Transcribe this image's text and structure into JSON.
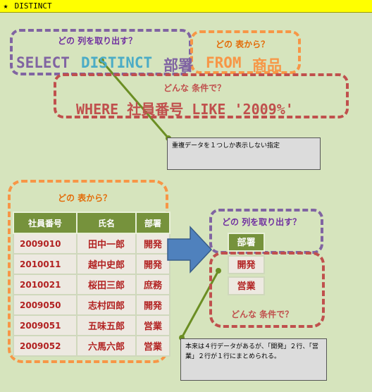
{
  "window": {
    "title": "DISTINCT"
  },
  "colors": {
    "purple": "#8064a2",
    "orange": "#f79646",
    "red": "#c0504d",
    "green_line": "#6b8e23",
    "header_green": "#76923c",
    "arrow_blue": "#4f81bd",
    "teal": "#4bacc6"
  },
  "labels": {
    "which_columns": "どの 列を取り出す？",
    "from_which_table": "どの 表から？",
    "what_condition": "どんな 条件で？"
  },
  "sql": {
    "select_kw": "SELECT",
    "distinct_kw": "DISTINCT",
    "column": "部署",
    "from_kw": "FROM",
    "table": "商品",
    "where_clause": "WHERE 社員番号 LIKE '2009%'"
  },
  "notes": {
    "distinct_note": "重複データを１つしか表示しない指定",
    "result_note": "本来は４行データがあるが、「開発」２行、「営業」２行が１行にまとめられる。"
  },
  "employees": {
    "headers": [
      "社員番号",
      "氏名",
      "部署"
    ],
    "rows": [
      [
        "2009010",
        "田中一郎",
        "開発"
      ],
      [
        "2010011",
        "越中史郎",
        "開発"
      ],
      [
        "2010021",
        "桜田三郎",
        "庶務"
      ],
      [
        "2009050",
        "志村四郎",
        "開発"
      ],
      [
        "2009051",
        "五味五郎",
        "営業"
      ],
      [
        "2009052",
        "六馬六郎",
        "営業"
      ]
    ]
  },
  "result": {
    "header": "部署",
    "values": [
      "開発",
      "営業"
    ]
  }
}
